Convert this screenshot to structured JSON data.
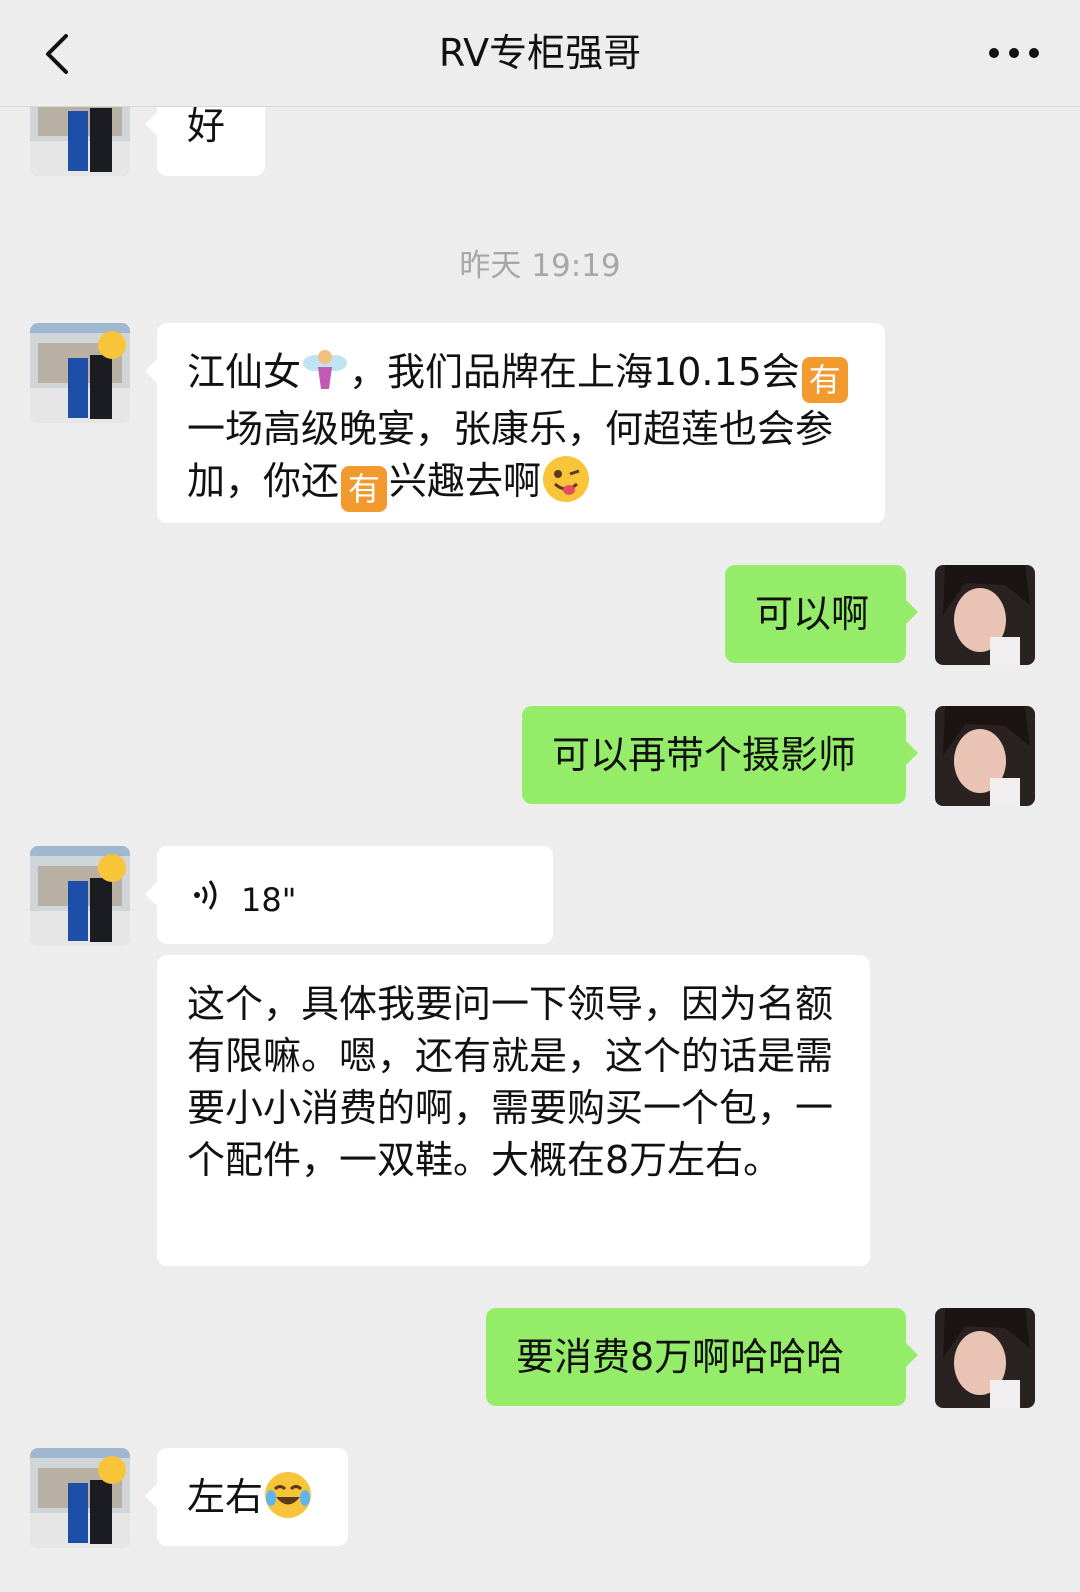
{
  "header": {
    "title": "RV专柜强哥"
  },
  "timestamp": "昨天 19:19",
  "messages": {
    "m0": {
      "text": "好"
    },
    "m1": {
      "p1": "江仙女",
      "p2": "，我们品牌在上海10.15会",
      "badge": "有",
      "p3": "一场高级晚宴，张康乐，何超莲也会参加，你还",
      "p4": "兴趣去啊"
    },
    "m2": {
      "text": "可以啊"
    },
    "m3": {
      "text": "可以再带个摄影师"
    },
    "m4": {
      "duration": "18\""
    },
    "m5": {
      "text": "这个，具体我要问一下领导，因为名额有限嘛。嗯，还有就是，这个的话是需要小小消费的啊，需要购买一个包，一个配件，一双鞋。大概在8万左右。"
    },
    "m6": {
      "text": "要消费8万啊哈哈哈"
    },
    "m7": {
      "text": "左右"
    }
  },
  "colors": {
    "incoming": "#ffffff",
    "outgoing": "#95ec69",
    "background": "#ededed"
  }
}
